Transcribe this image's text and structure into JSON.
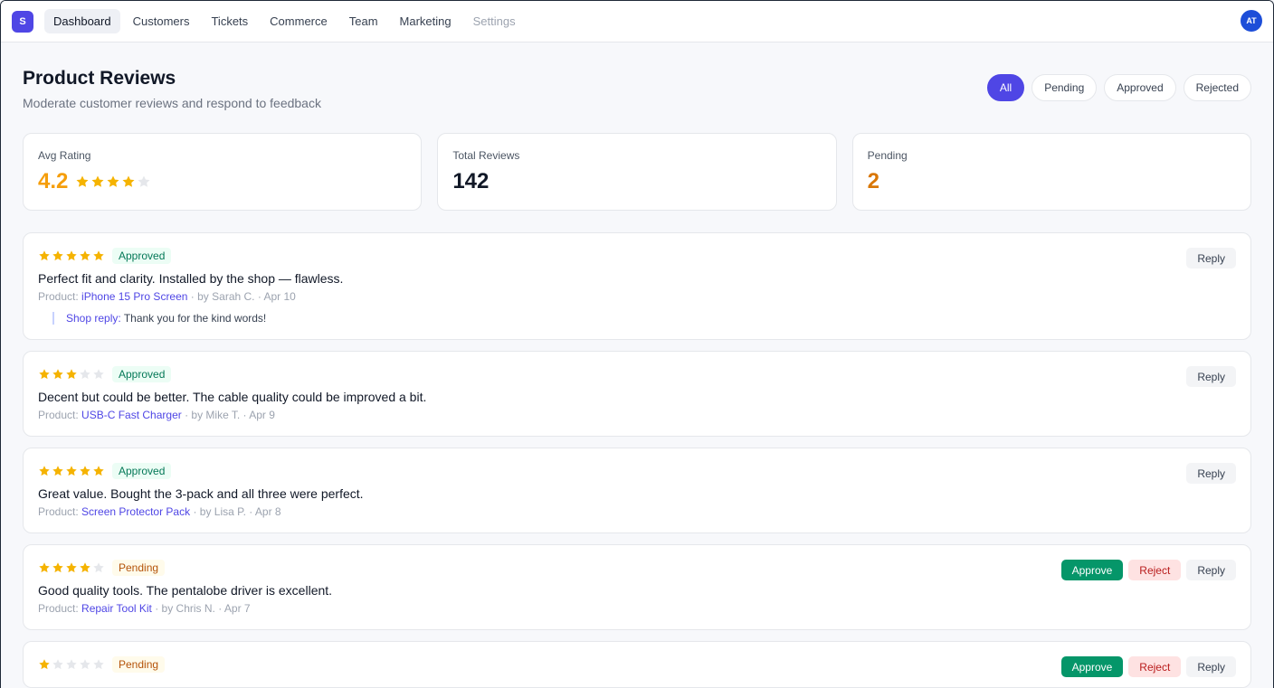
{
  "nav": {
    "logo": "S",
    "items": [
      "Dashboard",
      "Customers",
      "Tickets",
      "Commerce",
      "Team",
      "Marketing",
      "Settings"
    ],
    "avatar": "AT"
  },
  "page": {
    "title": "Product Reviews",
    "subtitle": "Moderate customer reviews and respond to feedback"
  },
  "filters": [
    "All",
    "Pending",
    "Approved",
    "Rejected"
  ],
  "stats": {
    "avg_rating": {
      "label": "Avg Rating",
      "value": "4.2",
      "stars_filled": 4
    },
    "total_reviews": {
      "label": "Total Reviews",
      "value": "142"
    },
    "pending": {
      "label": "Pending",
      "value": "2"
    }
  },
  "colors": {
    "accent": "#4f46e5",
    "star_filled": "#f5b301",
    "star_empty": "#e5e7eb",
    "approved": "#047857",
    "pending": "#b45309"
  },
  "labels": {
    "product_prefix": "Product:",
    "reply": "Reply",
    "approve": "Approve",
    "reject": "Reject",
    "shop_reply": "Shop reply:"
  },
  "reviews": [
    {
      "stars": 5,
      "status": "Approved",
      "text": "Perfect fit and clarity. Installed by the shop — flawless.",
      "product": "iPhone 15 Pro Screen",
      "byline": " · by Sarah C. · Apr 10",
      "reply": "Thank you for the kind words!"
    },
    {
      "stars": 3,
      "status": "Approved",
      "text": "Decent but could be better. The cable quality could be improved a bit.",
      "product": "USB-C Fast Charger",
      "byline": " · by Mike T. · Apr 9"
    },
    {
      "stars": 5,
      "status": "Approved",
      "text": "Great value. Bought the 3-pack and all three were perfect.",
      "product": "Screen Protector Pack",
      "byline": " · by Lisa P. · Apr 8"
    },
    {
      "stars": 4,
      "status": "Pending",
      "text": "Good quality tools. The pentalobe driver is excellent.",
      "product": "Repair Tool Kit",
      "byline": " · by Chris N. · Apr 7"
    },
    {
      "stars": 1,
      "status": "Pending",
      "text": "",
      "product": "",
      "byline": ""
    }
  ]
}
